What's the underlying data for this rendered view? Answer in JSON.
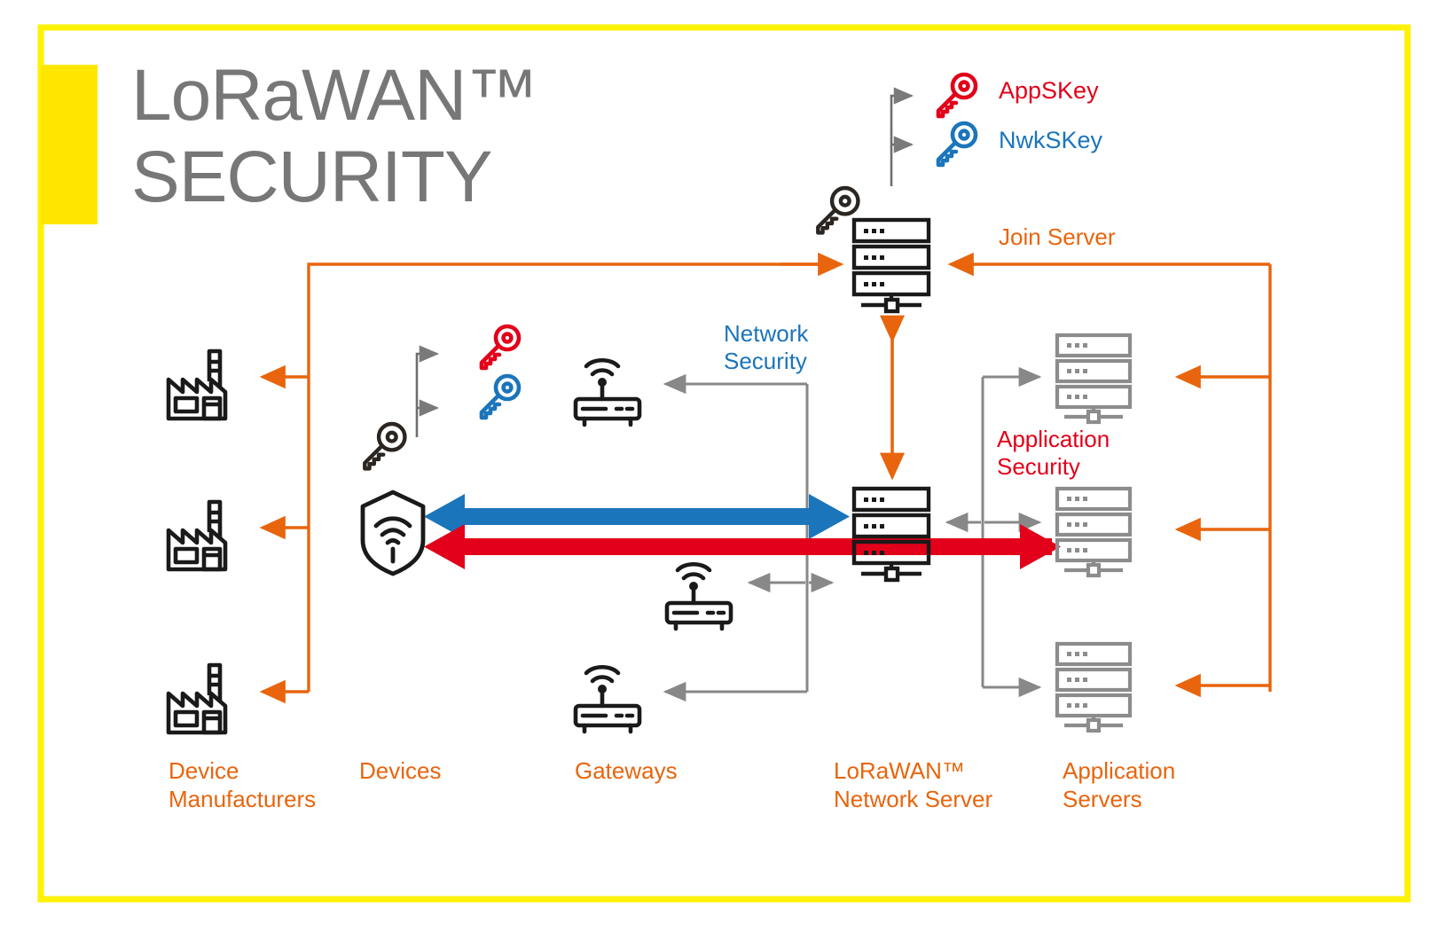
{
  "page": {
    "title_line1": "LoRaWAN™",
    "title_line2": "SECURITY",
    "background": "#FFFFFF",
    "frame_color": "#FFF200",
    "accent_block_color": "#FFE600"
  },
  "colors": {
    "orange": "#E8650D",
    "red": "#E2001A",
    "blue": "#1B75BB",
    "gray": "#888888",
    "black": "#1A1A1A",
    "server_gray": "#8C8C8C",
    "title_gray": "#777777"
  },
  "keys": {
    "join_server_keys": [
      {
        "name": "AppSKey",
        "color": "#E2001A",
        "icon": "key-icon"
      },
      {
        "name": "NwkSKey",
        "color": "#1B75BB",
        "icon": "key-icon"
      }
    ],
    "root_key_icon": "key-icon"
  },
  "labels": {
    "join_server": "Join Server",
    "network_security_line1": "Network",
    "network_security_line2": "Security",
    "application_security_line1": "Application",
    "application_security_line2": "Security"
  },
  "columns": [
    {
      "id": "device-manufacturers",
      "line1": "Device",
      "line2": "Manufacturers",
      "icon": "factory-icon",
      "count": 3
    },
    {
      "id": "devices",
      "line1": "Devices",
      "line2": "",
      "icon": "shield-wifi-icon",
      "count": 1
    },
    {
      "id": "gateways",
      "line1": "Gateways",
      "line2": "",
      "icon": "gateway-router-icon",
      "count": 3
    },
    {
      "id": "lorawan-network-server",
      "line1": "LoRaWAN™",
      "line2": "Network Server",
      "icon": "server-icon",
      "count": 1
    },
    {
      "id": "application-servers",
      "line1": "Application",
      "line2": "Servers",
      "icon": "server-icon",
      "count": 3
    }
  ],
  "flows": [
    {
      "id": "network-security-flow",
      "color": "#1B75BB",
      "from": "devices",
      "to": "lorawan-network-server",
      "style": "thick-double-arrow"
    },
    {
      "id": "application-security-flow",
      "color": "#E2001A",
      "from": "devices",
      "to": "application-servers",
      "style": "thick-double-arrow"
    },
    {
      "id": "join-server-to-network-server",
      "color": "#E8650D",
      "style": "vertical-double-arrow"
    },
    {
      "id": "join-server-to-manufacturers",
      "color": "#E8650D",
      "style": "bus-arrows"
    },
    {
      "id": "join-server-to-application-servers",
      "color": "#E8650D",
      "style": "bus-arrows"
    },
    {
      "id": "network-server-to-gateways",
      "color": "#888888",
      "style": "bus-arrows"
    },
    {
      "id": "network-server-to-application-servers",
      "color": "#888888",
      "style": "bus-arrows"
    }
  ]
}
